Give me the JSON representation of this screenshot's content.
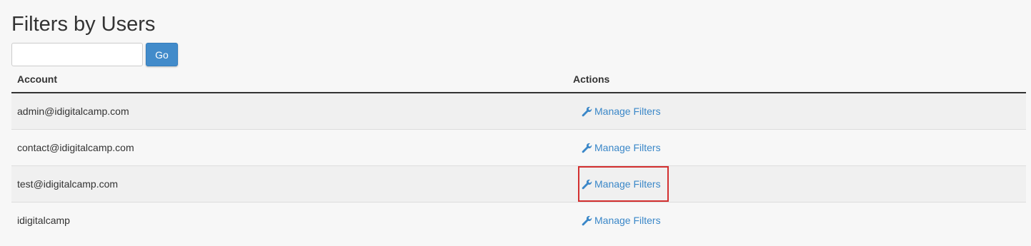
{
  "page": {
    "title": "Filters by Users"
  },
  "search": {
    "value": "",
    "placeholder": "",
    "go_label": "Go"
  },
  "table": {
    "headers": {
      "account": "Account",
      "actions": "Actions"
    },
    "rows": [
      {
        "account": "admin@idigitalcamp.com",
        "action": "Manage Filters",
        "highlighted": false
      },
      {
        "account": "contact@idigitalcamp.com",
        "action": "Manage Filters",
        "highlighted": false
      },
      {
        "account": "test@idigitalcamp.com",
        "action": "Manage Filters",
        "highlighted": true
      },
      {
        "account": "idigitalcamp",
        "action": "Manage Filters",
        "highlighted": false
      }
    ]
  },
  "icons": {
    "action_icon": "wrench-icon"
  },
  "colors": {
    "link": "#3a87c8",
    "button": "#428bca",
    "highlight": "#d32f2f"
  }
}
